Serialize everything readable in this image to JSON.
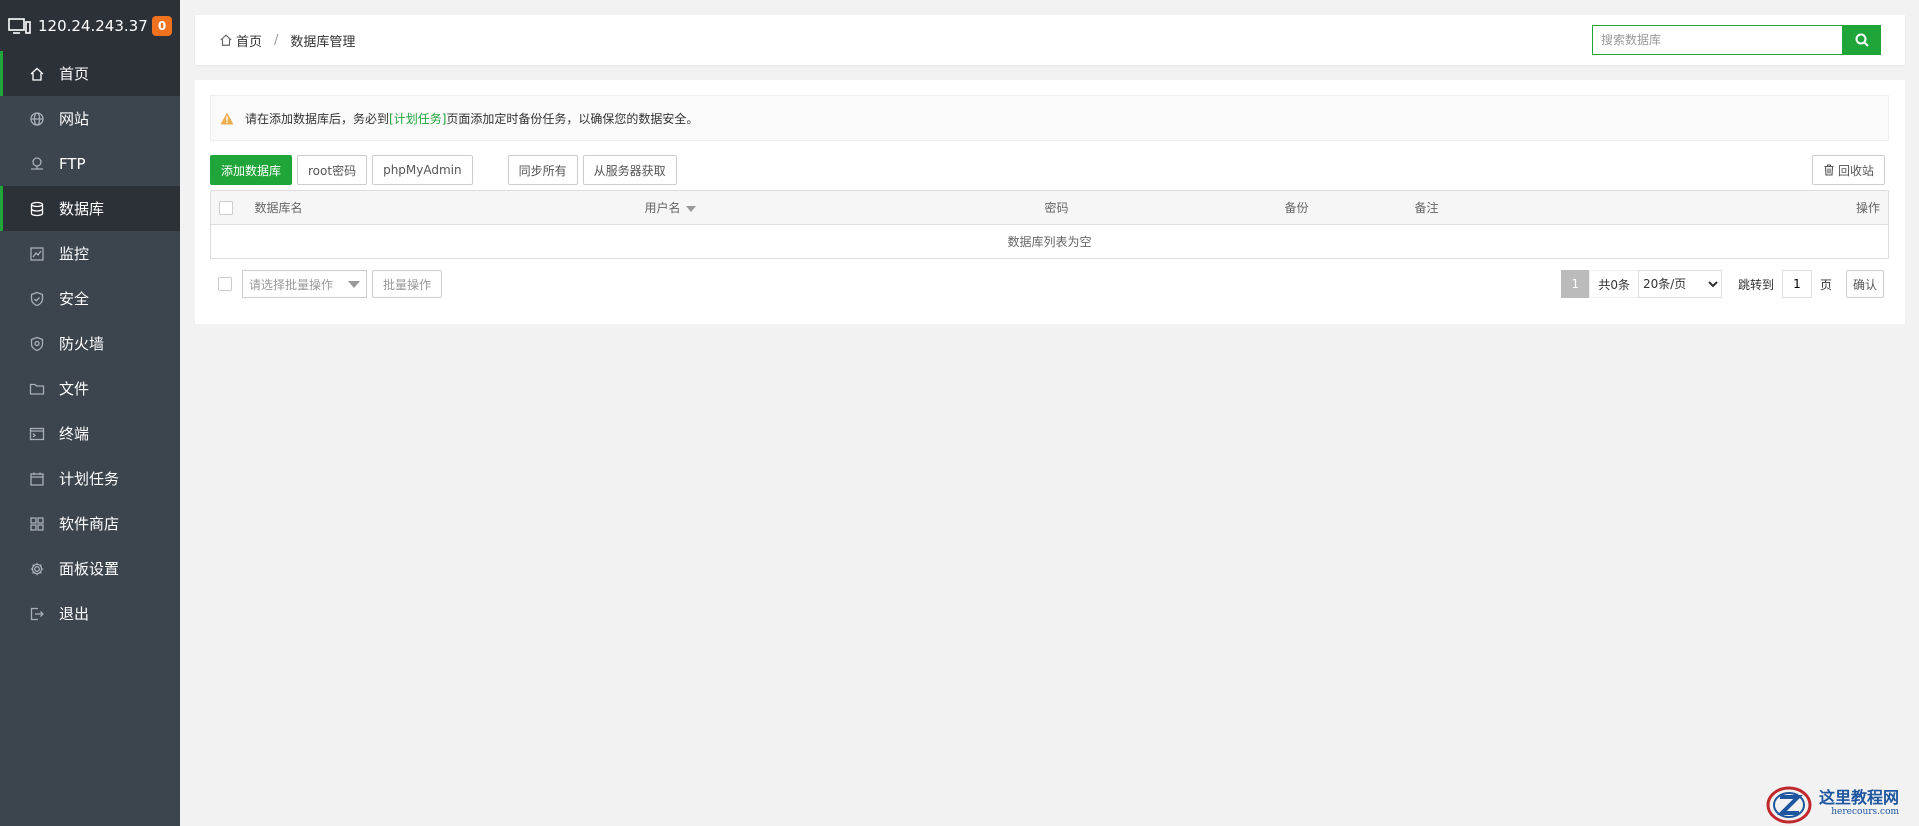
{
  "server": {
    "ip": "120.24.243.37",
    "badge": "0"
  },
  "nav": {
    "items": [
      {
        "label": "首页",
        "icon": "home-icon",
        "active": false,
        "first": true
      },
      {
        "label": "网站",
        "icon": "globe-icon",
        "active": false
      },
      {
        "label": "FTP",
        "icon": "ftp-icon",
        "active": false
      },
      {
        "label": "数据库",
        "icon": "database-icon",
        "active": true
      },
      {
        "label": "监控",
        "icon": "monitor-icon",
        "active": false
      },
      {
        "label": "安全",
        "icon": "shield-check-icon",
        "active": false
      },
      {
        "label": "防火墙",
        "icon": "firewall-shield-icon",
        "active": false
      },
      {
        "label": "文件",
        "icon": "folder-icon",
        "active": false
      },
      {
        "label": "终端",
        "icon": "terminal-icon",
        "active": false
      },
      {
        "label": "计划任务",
        "icon": "calendar-icon",
        "active": false
      },
      {
        "label": "软件商店",
        "icon": "grid-icon",
        "active": false
      },
      {
        "label": "面板设置",
        "icon": "gear-icon",
        "active": false
      },
      {
        "label": "退出",
        "icon": "logout-icon",
        "active": false
      }
    ]
  },
  "breadcrumb": {
    "home": "首页",
    "separator": "/",
    "current": "数据库管理"
  },
  "search": {
    "placeholder": "搜索数据库"
  },
  "alert": {
    "before": "请在添加数据库后，务必到",
    "link": "[计划任务]",
    "after": "页面添加定时备份任务，以确保您的数据安全。"
  },
  "toolbar": {
    "add": "添加数据库",
    "root_password": "root密码",
    "phpmyadmin": "phpMyAdmin",
    "sync_all": "同步所有",
    "fetch_from_server": "从服务器获取",
    "recycle_bin": "回收站"
  },
  "table": {
    "columns": [
      "数据库名",
      "用户名",
      "密码",
      "备份",
      "备注",
      "操作"
    ],
    "empty": "数据库列表为空"
  },
  "footer": {
    "batch_placeholder": "请选择批量操作",
    "batch_button": "批量操作"
  },
  "pager": {
    "current": "1",
    "total": "共0条",
    "page_size": "20条/页",
    "jump_label": "跳转到",
    "jump_value": "1",
    "unit": "页",
    "confirm": "确认"
  },
  "watermark": {
    "cn": "这里教程网",
    "en": "herecours.com"
  },
  "colors": {
    "accent": "#20a53a",
    "sidebar": "#3c444d",
    "sidebar_dark": "#2c3138",
    "badge": "#f0711e",
    "warning": "#f0ad4e"
  }
}
